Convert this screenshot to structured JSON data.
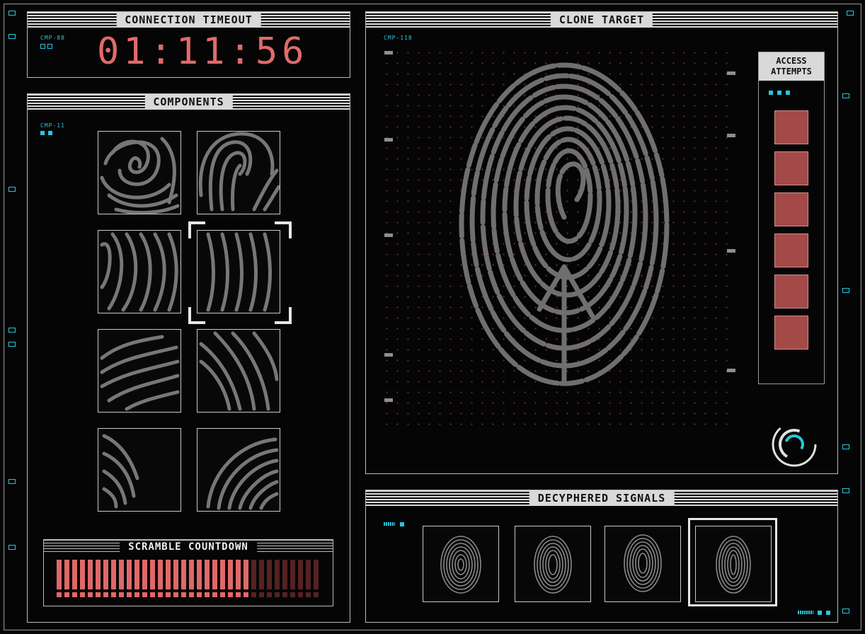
{
  "timeout": {
    "title": "CONNECTION TIMEOUT",
    "tag": "CMP-88",
    "time": "01:11:56"
  },
  "components": {
    "title": "COMPONENTS",
    "tag": "CMP-11"
  },
  "clone": {
    "title": "CLONE TARGET",
    "tag": "CMP-118",
    "access_title_1": "ACCESS",
    "access_title_2": "ATTEMPTS",
    "attempts_remaining": 6
  },
  "scramble": {
    "title": "SCRAMBLE COUNTDOWN",
    "total_bars": 34,
    "filled_bars": 25
  },
  "signals": {
    "title": "DECYPHERED SIGNALS"
  },
  "colors": {
    "accent_red": "#e06b6b",
    "accent_cyan": "#27c7d9",
    "panel_light": "#d9d9d9",
    "attempt_red": "#a34a48"
  }
}
